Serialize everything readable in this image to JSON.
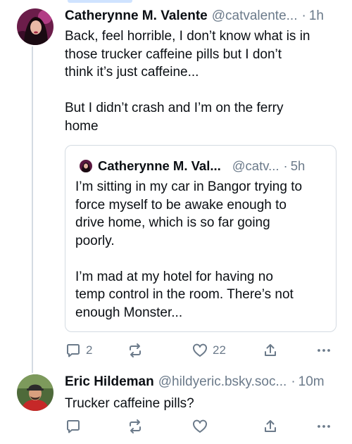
{
  "posts": [
    {
      "author": "Catherynne M. Valente",
      "handle": "@catvalente...",
      "separator": "·",
      "time": "1h",
      "paragraphs": [
        "Back, feel horrible, I don’t know what is in",
        "those trucker caffeine pills but I don’t",
        "think it’s just caffeine...",
        "",
        "But I didn’t crash and I’m on the ferry",
        "home"
      ],
      "quote": {
        "author": "Catherynne M. Val...",
        "handle": "@catv...",
        "separator": "·",
        "time": "5h",
        "lines": [
          "I’m sitting in my car in Bangor trying to",
          "force myself to be awake enough to",
          "drive home, which is so far going",
          "poorly.",
          "",
          "I’m mad at my hotel for having no",
          "temp control in the room. There’s not",
          "enough Monster..."
        ]
      },
      "actions": {
        "reply_count": "2",
        "repost_count": "",
        "like_count": "22"
      }
    },
    {
      "author": "Eric Hildeman",
      "handle": "@hildyeric.bsky.soc...",
      "separator": "·",
      "time": "10m",
      "text": "Trucker caffeine pills?",
      "actions": {
        "reply_count": "",
        "repost_count": "",
        "like_count": ""
      }
    }
  ],
  "icons": {
    "reply": "reply-icon",
    "repost": "repost-icon",
    "like": "heart-icon",
    "share": "share-icon",
    "more": "more-icon"
  },
  "colors": {
    "text": "#0b0f14",
    "muted": "#6b7a8a",
    "border": "#d4dbe2"
  }
}
